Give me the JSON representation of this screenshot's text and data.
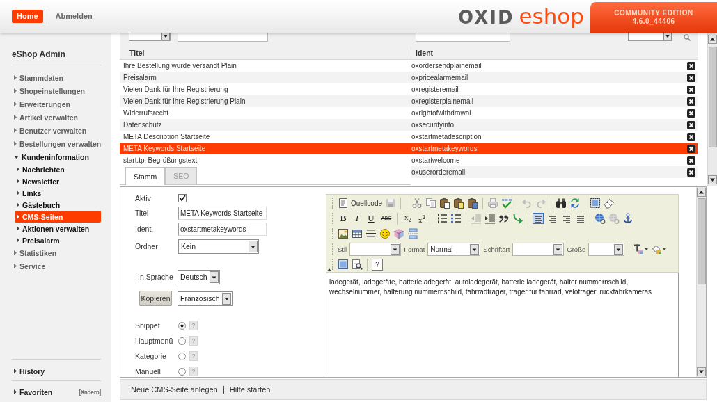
{
  "header": {
    "nav": [
      {
        "label": "Home",
        "selected": true
      },
      {
        "label": "Abmelden",
        "selected": false
      }
    ],
    "logo": {
      "brand": "OXID",
      "product": "eshop"
    },
    "edition": "COMMUNITY EDITION",
    "version": "4.6.0_44406"
  },
  "sidebar": {
    "title": "eShop Admin",
    "items": [
      {
        "label": "Stammdaten",
        "expanded": false
      },
      {
        "label": "Shopeinstellungen",
        "expanded": false
      },
      {
        "label": "Erweiterungen",
        "expanded": false
      },
      {
        "label": "Artikel verwalten",
        "expanded": false
      },
      {
        "label": "Benutzer verwalten",
        "expanded": false
      },
      {
        "label": "Bestellungen verwalten",
        "expanded": false
      },
      {
        "label": "Kundeninformation",
        "expanded": true,
        "children": [
          {
            "label": "Nachrichten",
            "selected": false
          },
          {
            "label": "Newsletter",
            "selected": false
          },
          {
            "label": "Links",
            "selected": false
          },
          {
            "label": "Gästebuch",
            "selected": false
          },
          {
            "label": "CMS-Seiten",
            "selected": true
          },
          {
            "label": "Aktionen verwalten",
            "selected": false
          },
          {
            "label": "Preisalarm",
            "selected": false
          }
        ]
      },
      {
        "label": "Statistiken",
        "expanded": false
      },
      {
        "label": "Service",
        "expanded": false
      }
    ],
    "history": {
      "label": "History",
      "expanded": false
    },
    "favorites": {
      "label": "Favoriten",
      "expanded": false,
      "edit_link": "[ändern]"
    }
  },
  "list": {
    "columns": [
      "Titel",
      "Ident"
    ],
    "rows": [
      {
        "title": "Ihre Bestellung wurde versandt Plain",
        "ident": "oxordersendplainemail",
        "selected": false
      },
      {
        "title": "Preisalarm",
        "ident": "oxpricealarmemail",
        "selected": false
      },
      {
        "title": "Vielen Dank für Ihre Registrierung",
        "ident": "oxregisteremail",
        "selected": false
      },
      {
        "title": "Vielen Dank für Ihre Registrierung Plain",
        "ident": "oxregisterplainemail",
        "selected": false
      },
      {
        "title": "Widerrufsrecht",
        "ident": "oxrightofwithdrawal",
        "selected": false
      },
      {
        "title": "Datenschutz",
        "ident": "oxsecurityinfo",
        "selected": false
      },
      {
        "title": "META Description Startseite",
        "ident": "oxstartmetadescription",
        "selected": false
      },
      {
        "title": "META Keywords Startseite",
        "ident": "oxstartmetakeywords",
        "selected": true
      },
      {
        "title": "start.tpl Begrüßungstext",
        "ident": "oxstartwelcome",
        "selected": false
      },
      {
        "ident": "oxuserorderemail",
        "selected": false
      }
    ]
  },
  "tabs": [
    {
      "label": "Stamm",
      "selected": true
    },
    {
      "label": "SEO",
      "selected": false
    }
  ],
  "form": {
    "fields": [
      {
        "kind": "checkbox",
        "label": "Aktiv",
        "checked": true
      },
      {
        "kind": "text",
        "label": "Titel",
        "value": "META Keywords Startseite"
      },
      {
        "kind": "text",
        "label": "Ident.",
        "value": "oxstartmetakeywords"
      },
      {
        "kind": "select",
        "label": "Ordner",
        "value": "Kein"
      }
    ],
    "language": {
      "label": "In Sprache",
      "value": "Deutsch"
    },
    "copy": {
      "button": "Kopieren",
      "target": "Französisch"
    },
    "types": [
      {
        "label": "Snippet",
        "selected": true,
        "help": "?"
      },
      {
        "label": "Hauptmenü",
        "selected": false,
        "help": "?"
      },
      {
        "label": "Kategorie",
        "selected": false,
        "help": "?"
      },
      {
        "label": "Manuell",
        "selected": false,
        "help": "?"
      }
    ]
  },
  "editor": {
    "source_button": "Quellcode",
    "style_buttons": [
      {
        "kind": "bold",
        "label": "B"
      },
      {
        "kind": "italic",
        "label": "I"
      },
      {
        "kind": "underline",
        "label": "U"
      },
      {
        "kind": "strike",
        "label": "ABC"
      }
    ],
    "script_buttons": [
      "x$_{2}$",
      "x$^{2}$"
    ],
    "align_buttons": [
      {
        "selected": true
      },
      {
        "selected": false
      },
      {
        "selected": false
      },
      {
        "selected": false
      }
    ],
    "dropdowns": [
      {
        "label": "Stil"
      },
      {
        "label": "Format",
        "value": "Normal"
      },
      {
        "label": "Schriftart"
      },
      {
        "label": "Größe"
      }
    ],
    "about_button": "?",
    "content": "ladegerät, ladegeräte, batterieladegerät, autoladegerät, batterie ladegerät, halter nummernschild, wechselnummer, halterung nummernschild, fahrradträger, träger für fahrrad, veloträger, rückfahrkameras"
  },
  "footer": {
    "actions": [
      "Neue CMS-Seite anlegen",
      "Hilfe starten"
    ]
  }
}
